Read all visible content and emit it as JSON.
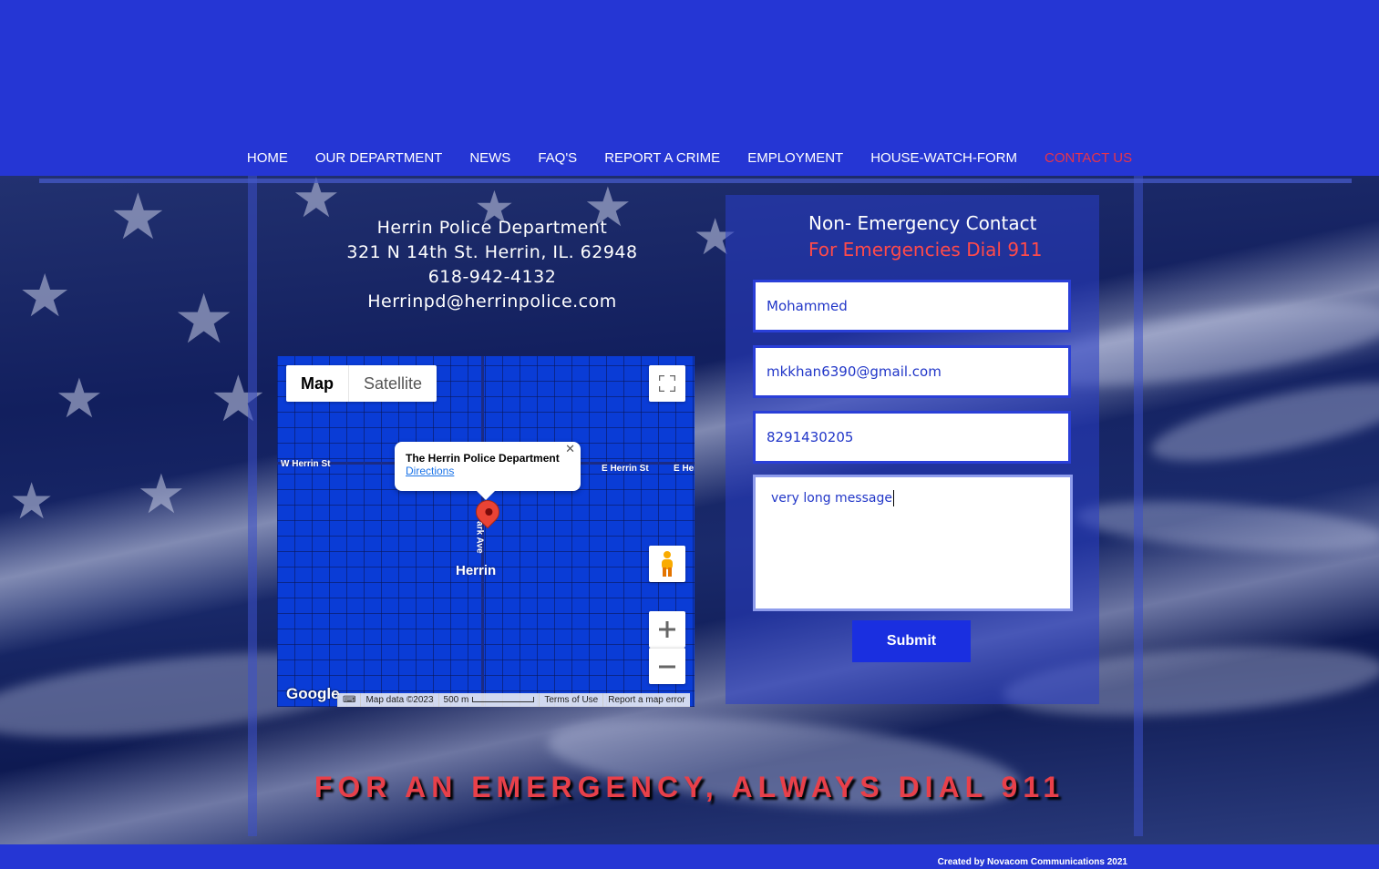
{
  "nav": {
    "items": [
      "HOME",
      "OUR DEPARTMENT",
      "NEWS",
      "FAQ'S",
      "REPORT A CRIME",
      "EMPLOYMENT",
      "HOUSE-WATCH-FORM",
      "CONTACT US"
    ],
    "active": "CONTACT US",
    "active_color": "#e8344a"
  },
  "contact": {
    "name": "Herrin Police Department",
    "address": "321 N 14th St. Herrin, IL. 62948",
    "phone": "618-942-4132",
    "email": "Herrinpd@herrinpolice.com"
  },
  "map": {
    "type_map": "Map",
    "type_satellite": "Satellite",
    "info_title": "The Herrin Police Department",
    "info_link": "Directions",
    "town_label": "Herrin",
    "street_w": "W Herrin St",
    "street_e": "E Herrin St",
    "street_e2": "E Her",
    "street_park": "N Park Ave",
    "logo": "Google",
    "footer_data": "Map data ©2023",
    "footer_scale": "500 m",
    "footer_terms": "Terms of Use",
    "footer_report": "Report a map error",
    "icons": [
      "fullscreen-icon",
      "pegman-icon",
      "zoom-in-icon",
      "zoom-out-icon",
      "keyboard-icon",
      "close-icon"
    ]
  },
  "form": {
    "title": "Non- Emergency Contact",
    "subtitle": "For Emergencies Dial 911",
    "name_value": "Mohammed",
    "email_value": "mkkhan6390@gmail.com",
    "phone_value": "8291430205",
    "message_value": "very long message",
    "submit_label": "Submit"
  },
  "emergency_banner": "FOR AN EMERGENCY, ALWAYS DIAL 911",
  "footer": {
    "credit": "Created by Novacom Communications 2021"
  },
  "colors": {
    "header_bg": "#2536d4",
    "accent_red": "#e8404a",
    "field_border": "#2a3fd8",
    "submit_bg": "#1a2fe0"
  }
}
